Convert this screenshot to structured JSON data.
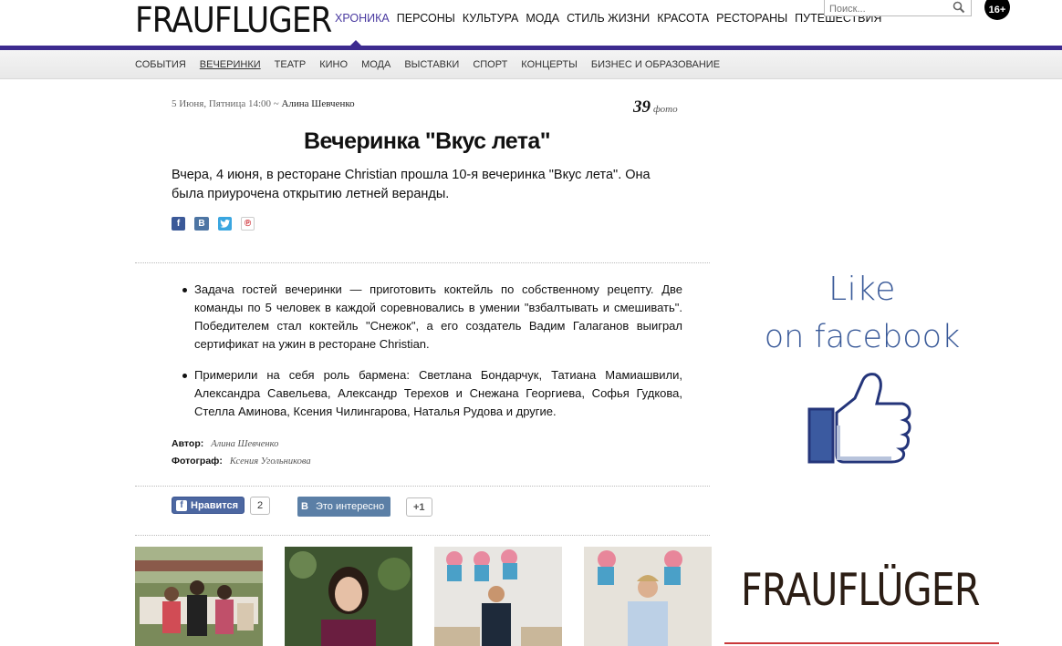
{
  "header": {
    "logo": "FRAUFLUGER",
    "nav": [
      "ХРОНИКА",
      "ПЕРСОНЫ",
      "КУЛЬТУРА",
      "МОДА",
      "СТИЛЬ ЖИЗНИ",
      "КРАСОТА",
      "РЕСТОРАНЫ",
      "ПУТЕШЕСТВИЯ"
    ],
    "active_nav": "ХРОНИКА",
    "search_placeholder": "Поиск...",
    "age_badge": "16+"
  },
  "subnav": {
    "items": [
      "СОБЫТИЯ",
      "ВЕЧЕРИНКИ",
      "ТЕАТР",
      "КИНО",
      "МОДА",
      "ВЫСТАВКИ",
      "СПОРТ",
      "КОНЦЕРТЫ",
      "БИЗНЕС И ОБРАЗОВАНИЕ"
    ],
    "active": "ВЕЧЕРИНКИ"
  },
  "article": {
    "date": "5 Июня, Пятница 14:00 ~",
    "author": "Алина Шевченко",
    "photo_count": "39",
    "photo_label": "фото",
    "title": "Вечеринка \"Вкус лета\"",
    "lead": "Вчера, 4 июня, в ресторане Christian прошла 10-я вечеринка \"Вкус лета\". Она была приурочена открытию летней веранды.",
    "bullets": [
      "Задача гостей вечеринки — приготовить коктейль по собственному рецепту. Две команды по 5 человек в каждой соревновались в умении \"взбалтывать и смешивать\". Победителем стал коктейль \"Снежок\", а его создатель Вадим Галаганов выиграл сертификат на ужин в ресторане Christian.",
      "Примерили на себя роль бармена: Светлана Бондарчук, Татиана Мамиашвили, Александра Савельева,  Александр Терехов и Снежана Георгиева, Софья Гудкова, Стелла Аминова, Ксения Чилингарова, Наталья Рудова и другие."
    ],
    "credits": {
      "author_label": "Автор:",
      "author_value": "Алина Шевченко",
      "photographer_label": "Фотограф:",
      "photographer_value": "Ксения Угольникова"
    }
  },
  "share": {
    "icons": [
      "facebook-icon",
      "vkontakte-icon",
      "twitter-icon",
      "pinterest-icon"
    ]
  },
  "social": {
    "fb_like_label": "Нравится",
    "fb_count": "2",
    "vk_label": "Это интересно",
    "vk_count": "+1"
  },
  "sidebar": {
    "like_line1": "Like",
    "like_line2": "on facebook",
    "logo": "FRAUFLÜGER"
  },
  "colors": {
    "brand_purple": "#3d2b8f",
    "facebook_blue": "#3b5998",
    "vk_blue": "#5b7fa6",
    "accent_red": "#c9383a"
  }
}
